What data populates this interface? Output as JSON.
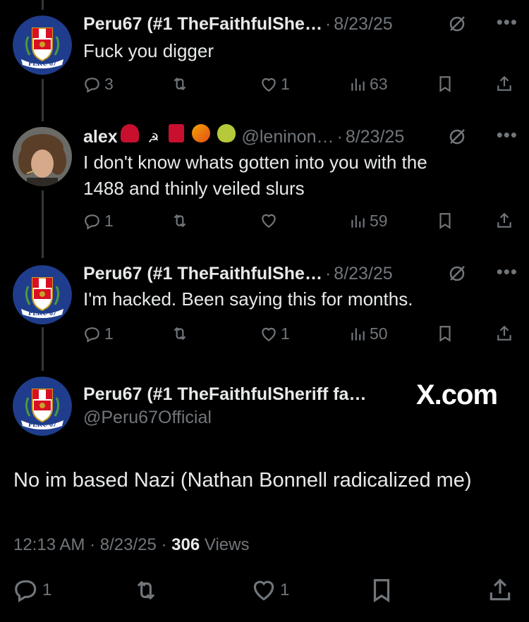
{
  "tweets": [
    {
      "name": "Peru67 (#1 TheFaithfulShe…",
      "handle": "",
      "date": "8/23/25",
      "text": "Fuck you digger",
      "replies": "3",
      "reposts": "",
      "likes": "1",
      "views": "63",
      "avatar": "peru67-crest"
    },
    {
      "name": "alex",
      "name_emojis": [
        "rose",
        "hammer-sickle",
        "red-book",
        "mango",
        "pear"
      ],
      "handle": "@leninon…",
      "date": "8/23/25",
      "text_lines": [
        "I don't know whats gotten into you with the",
        "1488 and thinly veiled slurs"
      ],
      "replies": "1",
      "reposts": "",
      "likes": "",
      "views": "59",
      "avatar": "alex-photo"
    },
    {
      "name": "Peru67 (#1 TheFaithfulShe…",
      "handle": "",
      "date": "8/23/25",
      "text": "I'm hacked. Been saying this for months.",
      "replies": "1",
      "reposts": "",
      "likes": "1",
      "views": "50",
      "avatar": "peru67-crest"
    }
  ],
  "main_tweet": {
    "name": "Peru67 (#1 TheFaithfulSheriff fa…",
    "handle": "@Peru67Official",
    "text": "No im based Nazi (Nathan Bonnell radicalized me)",
    "time": "12:13 AM",
    "date": "8/23/25",
    "views_count": "306",
    "views_label": "Views",
    "replies": "1",
    "reposts": "",
    "likes": "1"
  },
  "watermark": "X.com",
  "crest_caption": "PERÚ 67",
  "colors": {
    "background": "#000000",
    "text_primary": "#e7e9ea",
    "text_secondary": "#71767b",
    "crest_blue": "#1f3d8c",
    "thread_line": "#333639"
  }
}
